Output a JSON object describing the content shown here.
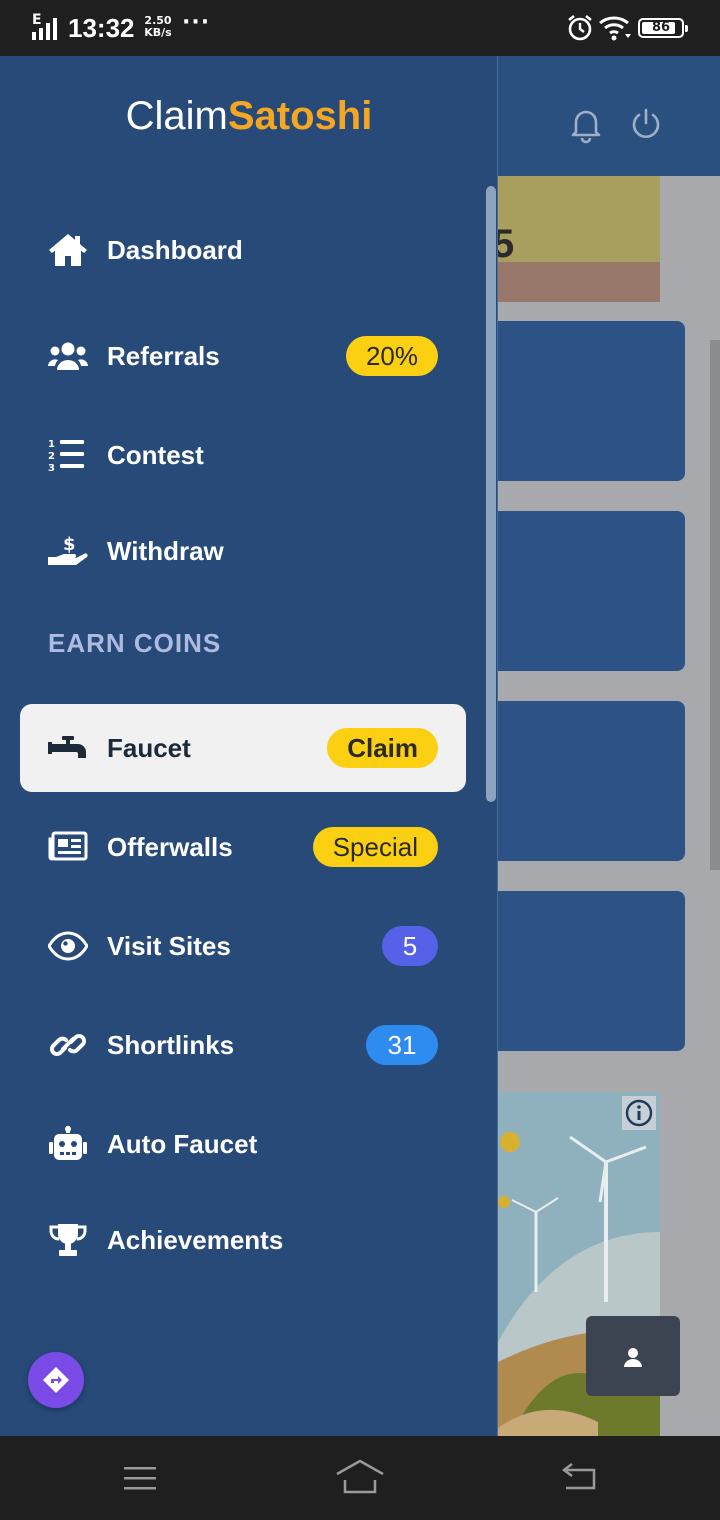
{
  "status_bar": {
    "network_letter": "E",
    "time": "13:32",
    "speed_value": "2.50",
    "speed_unit": "KB/s",
    "more": "···",
    "battery": "86",
    "battery_level": 0.86
  },
  "brand": {
    "part1": "Claim",
    "part2": "Satoshi",
    "accent_color": "#f5a623"
  },
  "nav": {
    "items": [
      {
        "label": "Dashboard",
        "icon": "home-icon"
      },
      {
        "label": "Referrals",
        "icon": "users-icon",
        "badge": "20%"
      },
      {
        "label": "Contest",
        "icon": "list-ol-icon"
      },
      {
        "label": "Withdraw",
        "icon": "hand-dollar-icon"
      }
    ],
    "section_title": "EARN COINS",
    "earn_items": [
      {
        "label": "Faucet",
        "icon": "faucet-icon",
        "badge": "Claim",
        "active": true
      },
      {
        "label": "Offerwalls",
        "icon": "newspaper-icon",
        "badge": "Special"
      },
      {
        "label": "Visit Sites",
        "icon": "eye-icon",
        "badge": "5"
      },
      {
        "label": "Shortlinks",
        "icon": "link-icon",
        "badge": "31"
      },
      {
        "label": "Auto Faucet",
        "icon": "robot-icon"
      },
      {
        "label": "Achievements",
        "icon": "trophy-icon"
      }
    ]
  },
  "colors": {
    "drawer_bg": "#274a79",
    "badge_yellow": "#fcd012",
    "badge_indigo": "#5561e6",
    "badge_blue": "#2e8bf0",
    "assist_purple": "#7b4be8"
  }
}
